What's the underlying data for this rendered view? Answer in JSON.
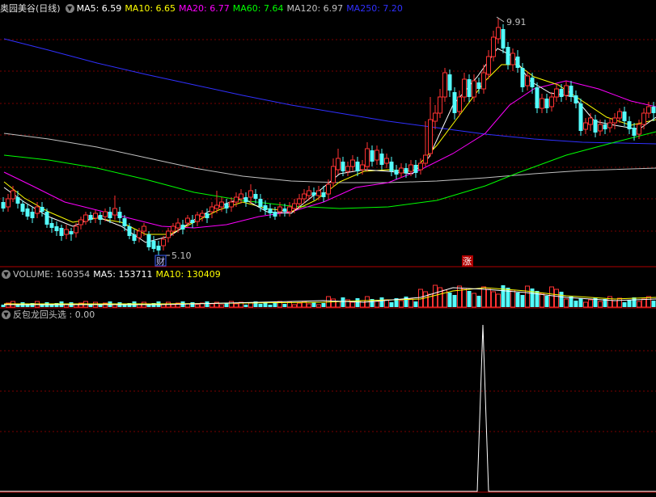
{
  "price_panel": {
    "title": "奥园美谷(日线)",
    "ma_items": [
      {
        "label": "MA5: 6.59",
        "color": "#ffffff"
      },
      {
        "label": "MA10: 6.65",
        "color": "#ffff00"
      },
      {
        "label": "MA20: 6.77",
        "color": "#ff00ff"
      },
      {
        "label": "MA60: 7.64",
        "color": "#00ff00"
      },
      {
        "label": "MA120: 6.97",
        "color": "#c0c0c0"
      },
      {
        "label": "MA250: 7.20",
        "color": "#3030ff"
      }
    ],
    "high_label": "9.91",
    "low_label": "5.10",
    "marker_cai": "财",
    "marker_zhang": "涨"
  },
  "volume_panel": {
    "items": [
      {
        "label": "VOLUME: 160354",
        "color": "#c0c0c0"
      },
      {
        "label": "MA5: 153711",
        "color": "#ffffff"
      },
      {
        "label": "MA10: 130409",
        "color": "#ffff00"
      }
    ]
  },
  "indicator_panel": {
    "label": "反包龙回头选 : 0.00"
  },
  "colors": {
    "up": "#ff3232",
    "down": "#54fcfc",
    "grid": "#7a0000",
    "border": "#b00000"
  }
}
